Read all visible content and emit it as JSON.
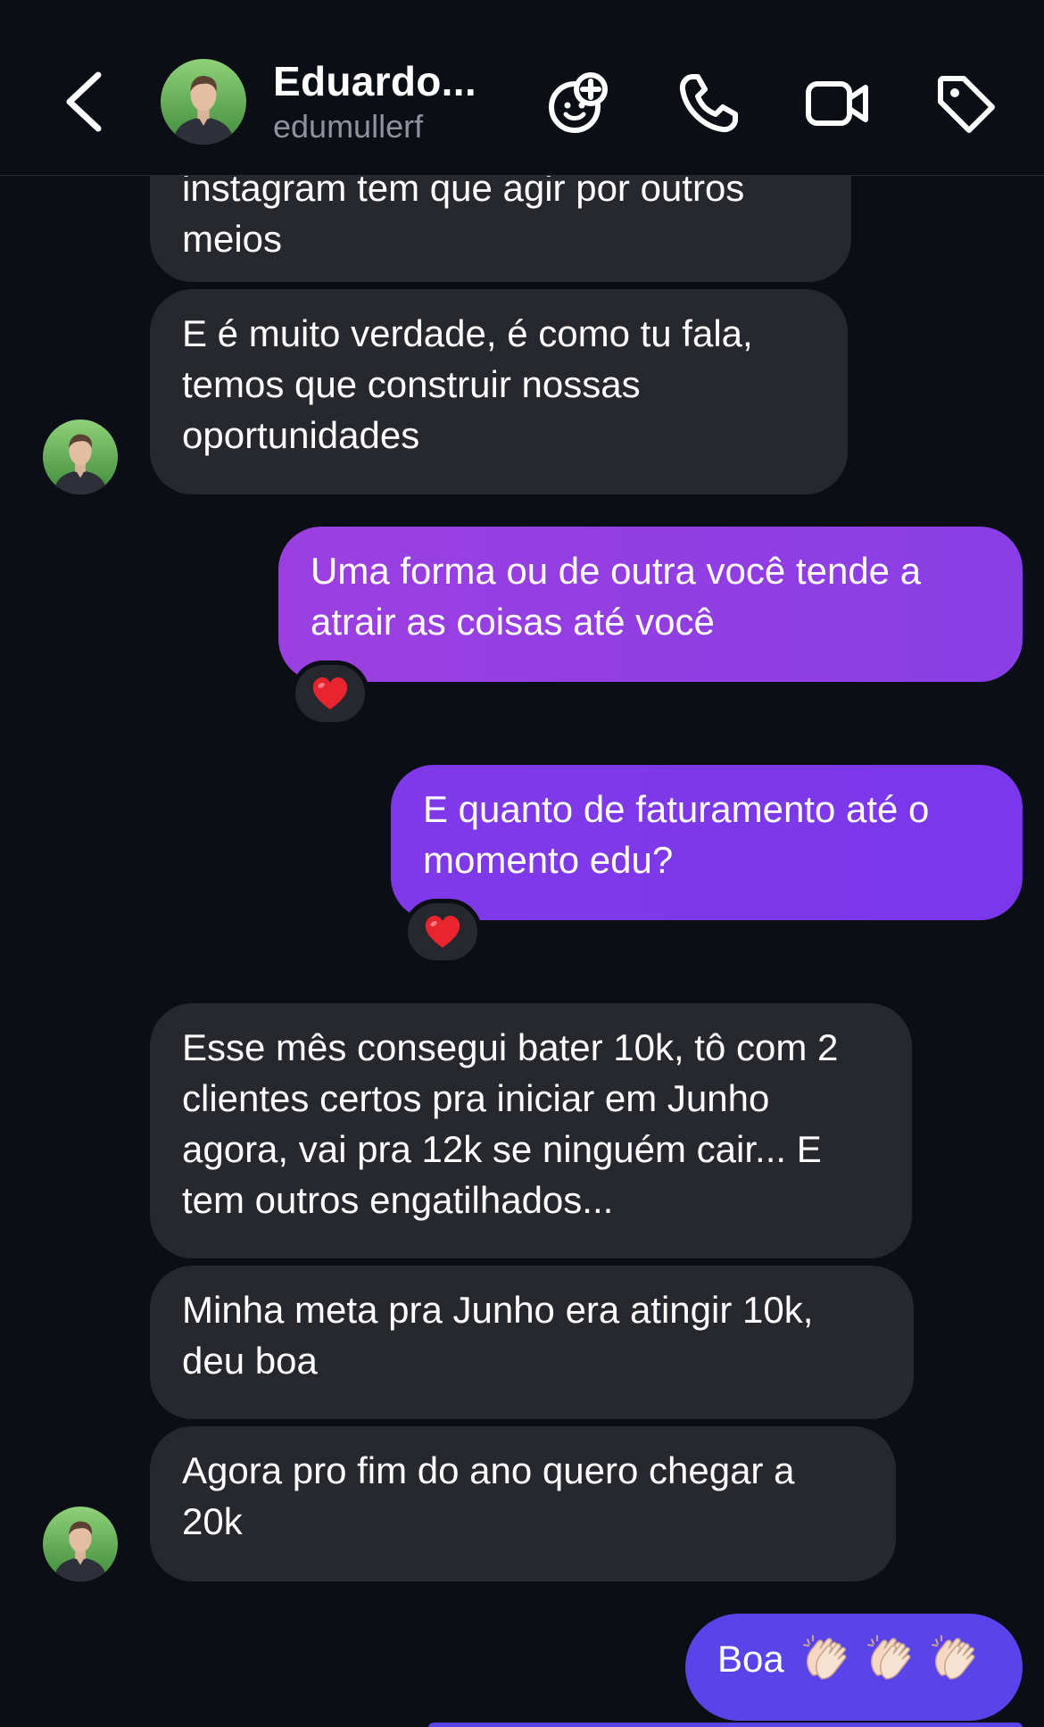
{
  "header": {
    "name": "Eduardo...",
    "handle": "edumullerf",
    "icons": [
      "back-chevron-icon",
      "add-sticker-icon",
      "phone-icon",
      "video-camera-icon",
      "tag-icon"
    ]
  },
  "colors": {
    "background": "#0c0e15",
    "incoming_bubble": "#26282e",
    "outgoing_purple": "#9b3fe0",
    "outgoing_violet": "#7a38ea",
    "outgoing_blue": "#5b43ea",
    "secondary_text": "#8e929c"
  },
  "messages": [
    {
      "direction": "in",
      "text": "instagram tem que agir por outros meios"
    },
    {
      "direction": "in",
      "text": "E é muito verdade, é como tu fala, temos que construir nossas oportunidades"
    },
    {
      "direction": "out",
      "text": "Uma forma ou de outra você tende a atrair as coisas até você",
      "reaction": "heart-emoji"
    },
    {
      "direction": "out",
      "text": "E quanto de faturamento até o momento edu?",
      "reaction": "heart-emoji"
    },
    {
      "direction": "in",
      "text": "Esse mês consegui bater 10k, tô com 2 clientes certos pra iniciar em Junho agora, vai pra 12k se ninguém cair... E tem outros engatilhados..."
    },
    {
      "direction": "in",
      "text": "Minha meta pra Junho era atingir 10k, deu boa"
    },
    {
      "direction": "in",
      "text": "Agora pro fim do ano quero chegar a 20k"
    },
    {
      "direction": "out",
      "text": "Boa",
      "emoji": [
        "clapping-hands-emoji",
        "clapping-hands-emoji",
        "clapping-hands-emoji"
      ]
    }
  ]
}
